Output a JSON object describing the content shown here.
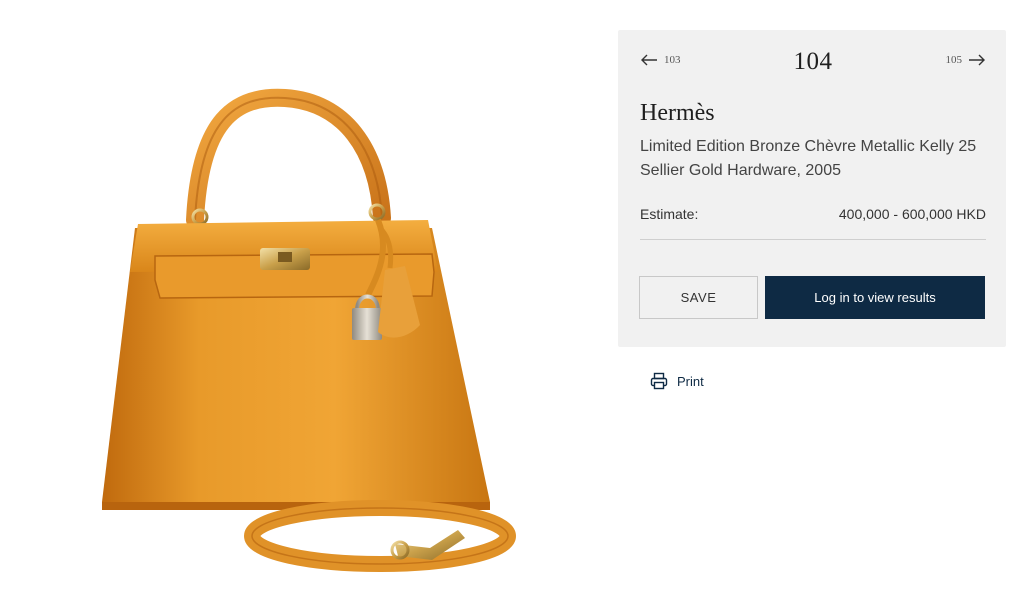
{
  "lot": {
    "number": "104",
    "prev_label": "103",
    "next_label": "105",
    "maker": "Hermès",
    "title": "Limited Edition Bronze Chèvre Metallic Kelly 25 Sellier Gold Hardware, 2005",
    "estimate_label": "Estimate:",
    "estimate_value": "400,000 - 600,000 HKD"
  },
  "actions": {
    "save_label": "SAVE",
    "login_label": "Log in to view results",
    "print_label": "Print"
  },
  "icons": {
    "prev": "arrow-left-icon",
    "next": "arrow-right-icon",
    "print": "printer-icon"
  },
  "colors": {
    "panel_bg": "#f1f1f1",
    "primary_button": "#0e2a44",
    "bag_main": "#e0901f"
  }
}
